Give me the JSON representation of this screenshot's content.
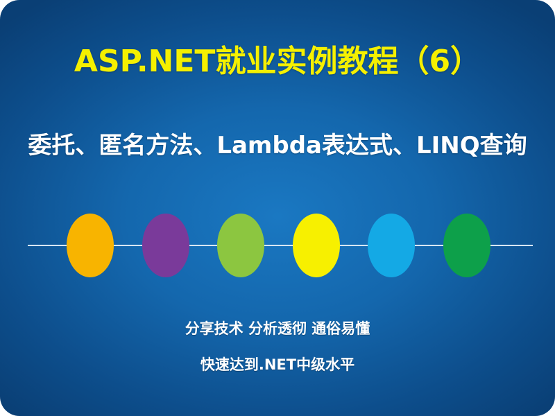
{
  "slide": {
    "title": "ASP.NET就业实例教程（6）",
    "subtitle": "委托、匿名方法、Lambda表达式、LINQ查询",
    "tagline": "分享技术 分析透彻 通俗易懂",
    "tagline2": "快速达到.NET中级水平",
    "colors": {
      "background": "#1467ad",
      "title": "#f5f000",
      "text": "#ffffff",
      "line": "#d7e6f3"
    },
    "dots": [
      {
        "name": "orange-circle",
        "color": "#f8b400"
      },
      {
        "name": "purple-circle",
        "color": "#7a3a9a"
      },
      {
        "name": "green-circle",
        "color": "#8cc640"
      },
      {
        "name": "yellow-circle",
        "color": "#f7f000"
      },
      {
        "name": "lightblue-circle",
        "color": "#14a9e5"
      },
      {
        "name": "darkgreen-circle",
        "color": "#0da04a"
      }
    ]
  }
}
